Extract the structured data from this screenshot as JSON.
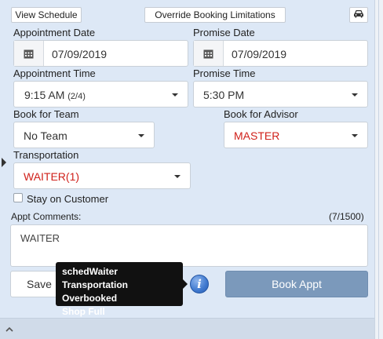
{
  "toolbar": {
    "view_schedule_label": "View Schedule",
    "override_label": "Override Booking Limitations",
    "vehicle_icon": "car-icon"
  },
  "form": {
    "appointment_date": {
      "label": "Appointment Date",
      "value": "07/09/2019"
    },
    "promise_date": {
      "label": "Promise Date",
      "value": "07/09/2019"
    },
    "appointment_time": {
      "label": "Appointment Time",
      "value": "9:15 AM",
      "sub": "(2/4)"
    },
    "promise_time": {
      "label": "Promise Time",
      "value": "5:30 PM"
    },
    "book_for_team": {
      "label": "Book for Team",
      "value": "No Team"
    },
    "book_for_advisor": {
      "label": "Book for Advisor",
      "value": "MASTER"
    },
    "transportation": {
      "label": "Transportation",
      "value": "WAITER(1)"
    },
    "stay_on_customer": {
      "label": "Stay on Customer",
      "checked": false
    },
    "comments": {
      "label": "Appt Comments:",
      "count": "(7/1500)",
      "value": "WAITER"
    }
  },
  "actions": {
    "save_label": "Save",
    "book_label": "Book Appt"
  },
  "tooltip": {
    "lines": [
      "schedWaiter",
      "Transportation Overbooked",
      "Shop Full"
    ]
  },
  "colors": {
    "panel_bg": "#dde8f6",
    "red_value": "#d0201a",
    "book_button": "#7b99bb",
    "info_icon": "#3f79cf"
  },
  "icons": [
    "calendar-icon",
    "car-icon",
    "info-icon",
    "chevron-down-icon",
    "left-arrow-icon",
    "caret-up-icon"
  ]
}
